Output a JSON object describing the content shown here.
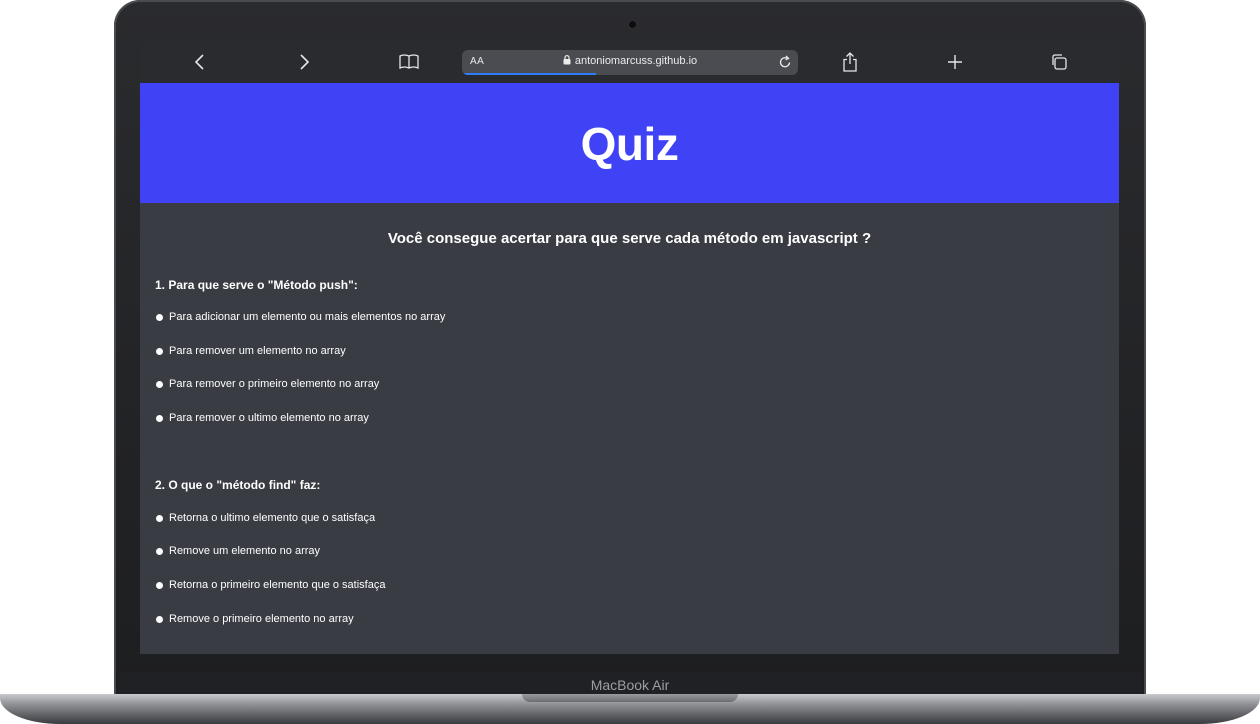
{
  "device": {
    "label": "MacBook Air"
  },
  "browser": {
    "text_size_label": "AA",
    "url": "antoniomarcuss.github.io",
    "icons": {
      "back": "chevron-left-icon",
      "forward": "chevron-right-icon",
      "bookmarks": "open-book-icon",
      "lock": "lock-icon",
      "reload": "reload-icon",
      "share": "share-icon",
      "new_tab": "plus-icon",
      "tabs": "tabs-icon"
    }
  },
  "page": {
    "header_color": "#3f42f5",
    "background_color": "#393c43",
    "title": "Quiz",
    "intro": "Você consegue acertar para que serve cada método em javascript ?",
    "questions": [
      {
        "text": "1. Para que serve o \"Método push\":",
        "options": [
          "Para adicionar um elemento ou mais elementos no array",
          "Para remover um elemento no array",
          "Para remover o primeiro elemento no array",
          "Para remover o ultimo elemento no array"
        ]
      },
      {
        "text": "2. O que o \"método find\" faz:",
        "options": [
          "Retorna o ultimo elemento que o satisfaça",
          "Remove um elemento no array",
          "Retorna o primeiro elemento que o satisfaça",
          "Remove o primeiro elemento no array"
        ]
      }
    ]
  }
}
